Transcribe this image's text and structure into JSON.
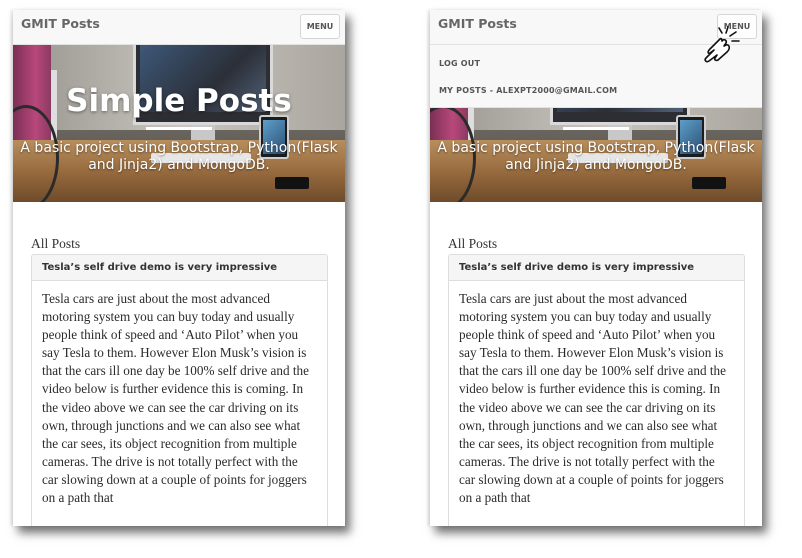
{
  "screens": [
    {
      "navbar": {
        "brand": "GMIT Posts",
        "menu_label": "MENU"
      },
      "hero": {
        "title": "Simple Posts",
        "subtitle": "A basic project using Bootstrap, Python(Flask and Jinja2) and MongoDB."
      },
      "posts": {
        "heading": "All Posts",
        "items": [
          {
            "title": "Tesla’s self drive demo is very impressive",
            "body": "Tesla cars are just about the most advanced motoring system you can buy today and usually people think of speed and ‘Auto Pilot’ when you say Tesla to them. However Elon Musk’s vision is that the cars ill one day be 100% self drive and the video below is further evidence this is coming. In the video above we can see the car driving on its own, through junctions and we can also see what the car sees, its object recognition from multiple cameras. The drive is not totally perfect with the car slowing down at a couple of points for joggers on a path that"
          }
        ]
      }
    },
    {
      "navbar": {
        "brand": "GMIT Posts",
        "menu_label": "MENU"
      },
      "dropdown": {
        "items": [
          {
            "label": "LOG OUT"
          },
          {
            "label": "MY POSTS - ALEXPT2000@GMAIL.COM"
          }
        ]
      },
      "hero": {
        "subtitle": "A basic project using Bootstrap, Python(Flask and Jinja2) and MongoDB."
      },
      "posts": {
        "heading": "All Posts",
        "items": [
          {
            "title": "Tesla’s self drive demo is very impressive",
            "body": "Tesla cars are just about the most advanced motoring system you can buy today and usually people think of speed and ‘Auto Pilot’ when you say Tesla to them. However Elon Musk’s vision is that the cars ill one day be 100% self drive and the video below is further evidence this is coming. In the video above we can see the car driving on its own, through junctions and we can also see what the car sees, its object recognition from multiple cameras. The drive is not totally perfect with the car slowing down at a couple of points for joggers on a path that"
          }
        ]
      }
    }
  ],
  "icons": {
    "cursor": "pointing-hand-click-icon"
  },
  "colors": {
    "navbar_bg": "#f8f8f8",
    "brand_text": "#666666",
    "panel_heading_bg": "#f5f5f5",
    "border": "#dddddd",
    "hero_text": "#ffffff"
  }
}
